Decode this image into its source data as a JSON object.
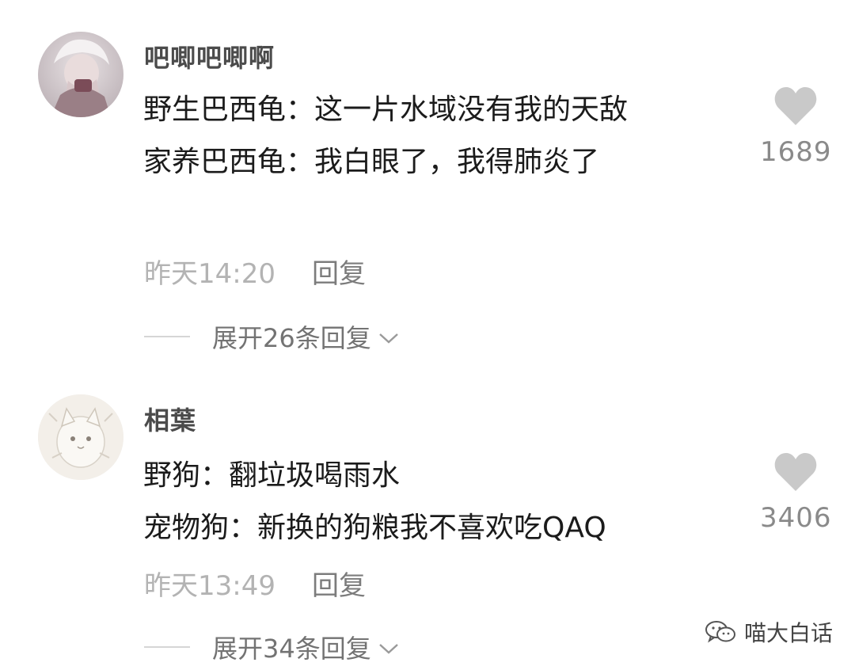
{
  "comments": [
    {
      "username": "吧唧吧唧啊",
      "lines": [
        "野生巴西龟：这一片水域没有我的天敌",
        "家养巴西龟：我白眼了，我得肺炎了"
      ],
      "time": "昨天14:20",
      "reply_label": "回复",
      "like_count": "1689",
      "expand_label": "展开26条回复"
    },
    {
      "username": "相葉",
      "lines": [
        "野狗：翻垃圾喝雨水",
        "宠物狗：新换的狗粮我不喜欢吃QAQ"
      ],
      "time": "昨天13:49",
      "reply_label": "回复",
      "like_count": "3406",
      "expand_label": "展开34条回复"
    }
  ],
  "watermark": {
    "text": "喵大白话",
    "icon": "wechat-icon"
  },
  "icons": {
    "like": "heart-icon",
    "expand": "chevron-down-icon"
  },
  "colors": {
    "heart": "#c9c9c9",
    "meta": "#b3b3b3"
  }
}
